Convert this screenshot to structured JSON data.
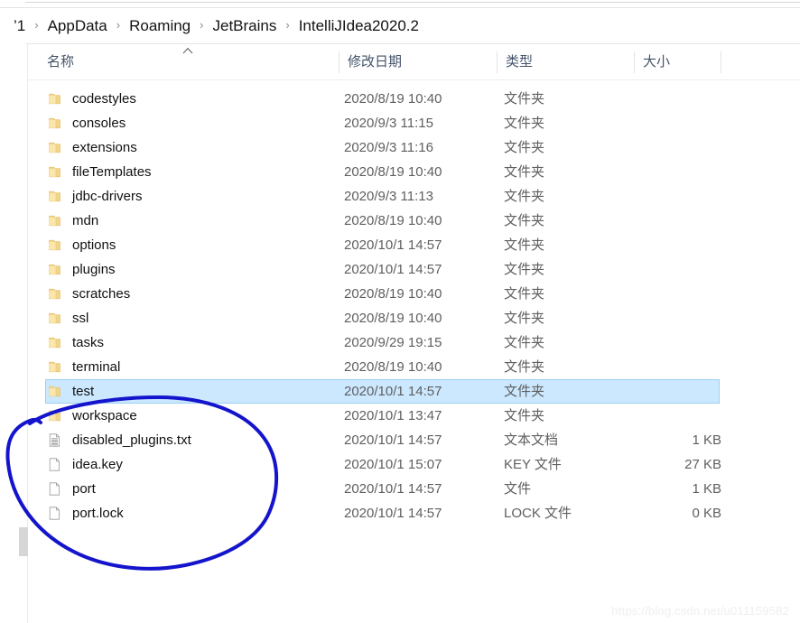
{
  "breadcrumb": {
    "separator": "›",
    "items": [
      {
        "label": "’1"
      },
      {
        "label": "AppData"
      },
      {
        "label": "Roaming"
      },
      {
        "label": "JetBrains"
      },
      {
        "label": "IntelliJIdea2020.2"
      }
    ]
  },
  "columns": {
    "name": "名称",
    "date_modified": "修改日期",
    "type": "类型",
    "size": "大小",
    "sort_icon": "chevron-up-icon"
  },
  "rows": [
    {
      "icon": "folder-icon",
      "name": "codestyles",
      "date": "2020/8/19 10:40",
      "type": "文件夹",
      "size": "",
      "selected": false
    },
    {
      "icon": "folder-icon",
      "name": "consoles",
      "date": "2020/9/3 11:15",
      "type": "文件夹",
      "size": "",
      "selected": false
    },
    {
      "icon": "folder-icon",
      "name": "extensions",
      "date": "2020/9/3 11:16",
      "type": "文件夹",
      "size": "",
      "selected": false
    },
    {
      "icon": "folder-icon",
      "name": "fileTemplates",
      "date": "2020/8/19 10:40",
      "type": "文件夹",
      "size": "",
      "selected": false
    },
    {
      "icon": "folder-icon",
      "name": "jdbc-drivers",
      "date": "2020/9/3 11:13",
      "type": "文件夹",
      "size": "",
      "selected": false
    },
    {
      "icon": "folder-icon",
      "name": "mdn",
      "date": "2020/8/19 10:40",
      "type": "文件夹",
      "size": "",
      "selected": false
    },
    {
      "icon": "folder-icon",
      "name": "options",
      "date": "2020/10/1 14:57",
      "type": "文件夹",
      "size": "",
      "selected": false
    },
    {
      "icon": "folder-icon",
      "name": "plugins",
      "date": "2020/10/1 14:57",
      "type": "文件夹",
      "size": "",
      "selected": false
    },
    {
      "icon": "folder-icon",
      "name": "scratches",
      "date": "2020/8/19 10:40",
      "type": "文件夹",
      "size": "",
      "selected": false
    },
    {
      "icon": "folder-icon",
      "name": "ssl",
      "date": "2020/8/19 10:40",
      "type": "文件夹",
      "size": "",
      "selected": false
    },
    {
      "icon": "folder-icon",
      "name": "tasks",
      "date": "2020/9/29 19:15",
      "type": "文件夹",
      "size": "",
      "selected": false
    },
    {
      "icon": "folder-icon",
      "name": "terminal",
      "date": "2020/8/19 10:40",
      "type": "文件夹",
      "size": "",
      "selected": false
    },
    {
      "icon": "folder-icon",
      "name": "test",
      "date": "2020/10/1 14:57",
      "type": "文件夹",
      "size": "",
      "selected": true
    },
    {
      "icon": "folder-icon",
      "name": "workspace",
      "date": "2020/10/1 13:47",
      "type": "文件夹",
      "size": "",
      "selected": false
    },
    {
      "icon": "text-file-icon",
      "name": "disabled_plugins.txt",
      "date": "2020/10/1 14:57",
      "type": "文本文档",
      "size": "1 KB",
      "selected": false
    },
    {
      "icon": "generic-file-icon",
      "name": "idea.key",
      "date": "2020/10/1 15:07",
      "type": "KEY 文件",
      "size": "27 KB",
      "selected": false
    },
    {
      "icon": "generic-file-icon",
      "name": "port",
      "date": "2020/10/1 14:57",
      "type": "文件",
      "size": "1 KB",
      "selected": false
    },
    {
      "icon": "generic-file-icon",
      "name": "port.lock",
      "date": "2020/10/1 14:57",
      "type": "LOCK 文件",
      "size": "0 KB",
      "selected": false
    }
  ],
  "annotation": {
    "shape": "hand-drawn-circle",
    "color": "#1414cc"
  },
  "watermark": {
    "text": "https://blog.csdn.net/u011159582"
  },
  "colors": {
    "selection_fill": "#cce8ff",
    "selection_border": "#99d1f2",
    "header_text": "#44546a",
    "folder_icon": "#f6d88f",
    "annotation_ink": "#1414cc"
  }
}
